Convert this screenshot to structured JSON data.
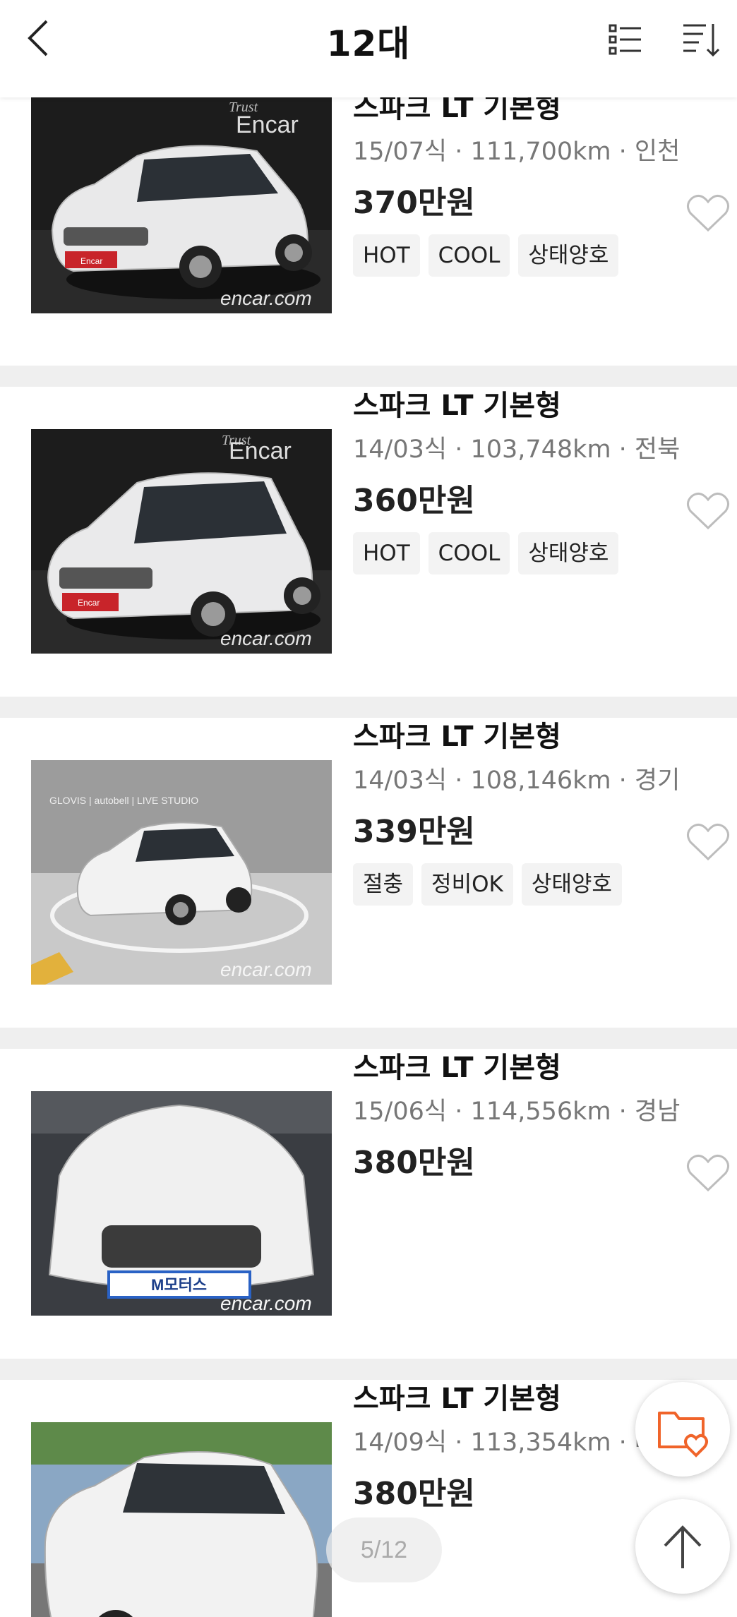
{
  "header": {
    "title": "12대",
    "back_icon": "chevron-left-icon",
    "list_view_icon": "list-view-icon",
    "sort_icon": "sort-icon"
  },
  "listings": [
    {
      "name": "스파크 LT 기본형",
      "meta": "15/07식 · 111,700km · 인천",
      "price": "370만원",
      "tags": [
        "HOT",
        "COOL",
        "상태양호"
      ],
      "watermark": "encar.com",
      "photo_brand": "Encar",
      "photo_brand_sub": "Trust",
      "plate": "Encar"
    },
    {
      "name": "스파크 LT 기본형",
      "meta": "14/03식 · 103,748km · 전북",
      "price": "360만원",
      "tags": [
        "HOT",
        "COOL",
        "상태양호"
      ],
      "watermark": "encar.com",
      "photo_brand": "Encar",
      "photo_brand_sub": "Trust",
      "plate": "Encar"
    },
    {
      "name": "스파크 LT 기본형",
      "meta": "14/03식 · 108,146km · 경기",
      "price": "339만원",
      "tags": [
        "절충",
        "정비OK",
        "상태양호"
      ],
      "watermark": "encar.com",
      "studio_text": "GLOVIS | autobell | LIVE STUDIO"
    },
    {
      "name": "스파크 LT 기본형",
      "meta": "15/06식 · 114,556km · 경남",
      "price": "380만원",
      "tags": [],
      "watermark": "encar.com",
      "plate": "M모터스"
    },
    {
      "name": "스파크 LT 기본형",
      "meta": "14/09식 · 113,354km · 대구",
      "price": "380만원",
      "tags": []
    }
  ],
  "pager": {
    "label": "5/12"
  },
  "fab": {
    "favorites_icon": "folder-heart-icon",
    "scroll_top_icon": "arrow-up-icon"
  },
  "colors": {
    "accent": "#f0642a",
    "separator": "#efefef",
    "muted": "#777777"
  }
}
